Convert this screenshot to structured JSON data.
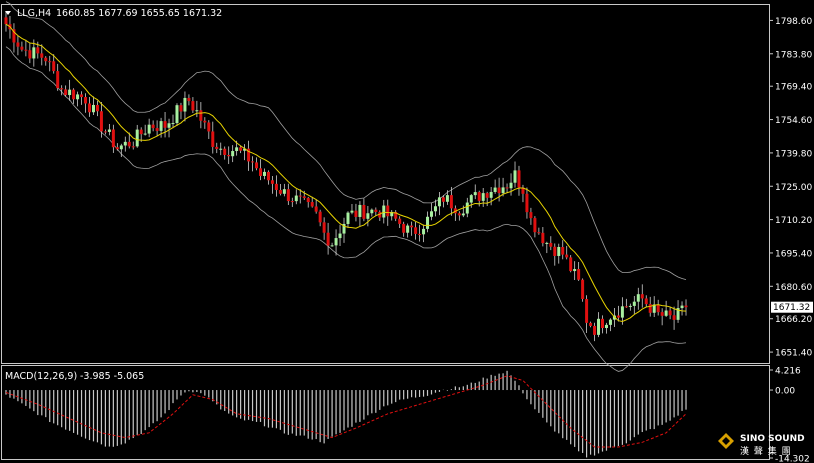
{
  "window": {
    "symbol": "LLG,H4",
    "ohlc": "1660.85 1677.69 1655.65 1671.32",
    "current_price": "1671.32"
  },
  "macd_header": {
    "label": "MACD(12,26,9)",
    "values": "-3.985 -5.065"
  },
  "macd_axis": {
    "ticks": [
      "4.216",
      "0.00",
      "-14.302"
    ]
  },
  "watermark": {
    "text": "SINO SOUND",
    "sub": "漢 聲 集 團"
  },
  "colors": {
    "background": "#000000",
    "frame": "#c8c8c8",
    "bull_candle": "#a8f0a0",
    "bear_candle": "#e01010",
    "wick": "#d0d0d0",
    "ma": "#e8d400",
    "bollinger": "#a0a0a0",
    "macd_hist": "#c8c8c8",
    "macd_signal": "#e01010"
  },
  "chart_data": {
    "type": "candlestick",
    "title": "LLG,H4",
    "y_ticks": [
      "1798.60",
      "1783.80",
      "1769.40",
      "1754.60",
      "1739.80",
      "1725.00",
      "1710.20",
      "1695.40",
      "1680.60",
      "1666.20",
      "1651.40"
    ],
    "ylim": [
      1647,
      1805
    ],
    "macd_ylim": [
      -14.302,
      4.216
    ],
    "close_anchors": [
      [
        0,
        1797
      ],
      [
        4,
        1786
      ],
      [
        10,
        1782
      ],
      [
        14,
        1768
      ],
      [
        20,
        1764
      ],
      [
        24,
        1752
      ],
      [
        28,
        1742
      ],
      [
        32,
        1745
      ],
      [
        36,
        1752
      ],
      [
        40,
        1752
      ],
      [
        44,
        1760
      ],
      [
        46,
        1763
      ],
      [
        48,
        1758
      ],
      [
        52,
        1745
      ],
      [
        54,
        1742
      ],
      [
        58,
        1741
      ],
      [
        62,
        1736
      ],
      [
        64,
        1730
      ],
      [
        66,
        1728
      ],
      [
        70,
        1722
      ],
      [
        74,
        1718
      ],
      [
        78,
        1712
      ],
      [
        80,
        1704
      ],
      [
        82,
        1700
      ],
      [
        86,
        1712
      ],
      [
        90,
        1714
      ],
      [
        94,
        1714
      ],
      [
        98,
        1710
      ],
      [
        102,
        1704
      ],
      [
        106,
        1710
      ],
      [
        110,
        1720
      ],
      [
        114,
        1715
      ],
      [
        118,
        1720
      ],
      [
        122,
        1724
      ],
      [
        126,
        1726
      ],
      [
        128,
        1730
      ],
      [
        130,
        1724
      ],
      [
        132,
        1710
      ],
      [
        136,
        1700
      ],
      [
        140,
        1695
      ],
      [
        144,
        1682
      ],
      [
        146,
        1666
      ],
      [
        148,
        1662
      ],
      [
        152,
        1668
      ],
      [
        156,
        1672
      ],
      [
        160,
        1675
      ],
      [
        164,
        1668
      ],
      [
        168,
        1666
      ],
      [
        171,
        1671
      ]
    ],
    "macd_hist_anchors": [
      [
        0,
        -1
      ],
      [
        6,
        -4
      ],
      [
        12,
        -7
      ],
      [
        20,
        -10
      ],
      [
        26,
        -12
      ],
      [
        30,
        -11
      ],
      [
        36,
        -8
      ],
      [
        40,
        -5
      ],
      [
        44,
        -1
      ],
      [
        46,
        0
      ],
      [
        50,
        -1
      ],
      [
        54,
        -4
      ],
      [
        58,
        -6
      ],
      [
        64,
        -7
      ],
      [
        70,
        -9
      ],
      [
        76,
        -10
      ],
      [
        80,
        -11
      ],
      [
        86,
        -8
      ],
      [
        92,
        -5
      ],
      [
        96,
        -3
      ],
      [
        100,
        -2
      ],
      [
        106,
        -1
      ],
      [
        110,
        0
      ],
      [
        116,
        1
      ],
      [
        122,
        3
      ],
      [
        126,
        4
      ],
      [
        128,
        2
      ],
      [
        132,
        -3
      ],
      [
        136,
        -7
      ],
      [
        140,
        -10
      ],
      [
        144,
        -13
      ],
      [
        146,
        -14
      ],
      [
        150,
        -13
      ],
      [
        156,
        -11
      ],
      [
        160,
        -9
      ],
      [
        166,
        -7
      ],
      [
        171,
        -4
      ]
    ],
    "macd_signal_anchors": [
      [
        0,
        -0.5
      ],
      [
        8,
        -3
      ],
      [
        16,
        -6
      ],
      [
        24,
        -9
      ],
      [
        30,
        -10
      ],
      [
        36,
        -9
      ],
      [
        42,
        -5
      ],
      [
        47,
        -1
      ],
      [
        52,
        -2
      ],
      [
        58,
        -5
      ],
      [
        66,
        -6
      ],
      [
        74,
        -8
      ],
      [
        82,
        -10
      ],
      [
        88,
        -8
      ],
      [
        96,
        -5
      ],
      [
        104,
        -3
      ],
      [
        112,
        -1
      ],
      [
        120,
        1
      ],
      [
        126,
        3
      ],
      [
        130,
        2
      ],
      [
        136,
        -3
      ],
      [
        142,
        -8
      ],
      [
        148,
        -12
      ],
      [
        154,
        -12
      ],
      [
        160,
        -11
      ],
      [
        166,
        -9
      ],
      [
        171,
        -5
      ]
    ],
    "bb_width": [
      [
        0,
        10
      ],
      [
        10,
        12
      ],
      [
        20,
        13
      ],
      [
        30,
        12
      ],
      [
        40,
        13
      ],
      [
        48,
        18
      ],
      [
        58,
        20
      ],
      [
        66,
        24
      ],
      [
        74,
        20
      ],
      [
        80,
        16
      ],
      [
        90,
        12
      ],
      [
        100,
        10
      ],
      [
        110,
        10
      ],
      [
        120,
        12
      ],
      [
        126,
        14
      ],
      [
        132,
        20
      ],
      [
        140,
        30
      ],
      [
        146,
        30
      ],
      [
        152,
        24
      ],
      [
        160,
        18
      ],
      [
        171,
        14
      ]
    ],
    "candle_count": 172
  }
}
